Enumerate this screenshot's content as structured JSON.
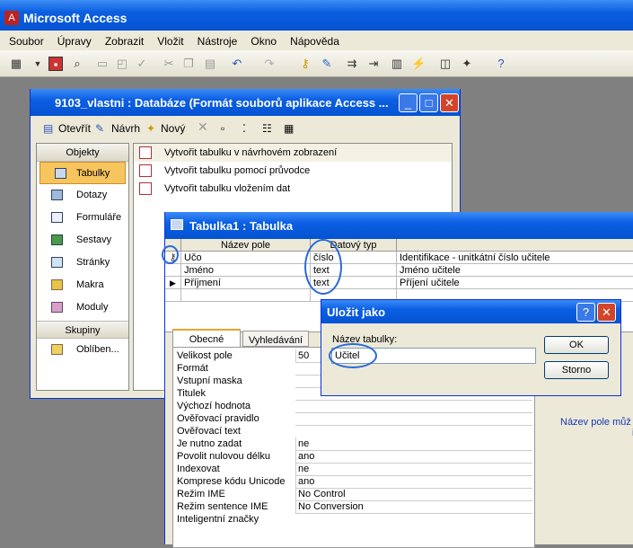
{
  "app": {
    "title": "Microsoft Access"
  },
  "menu": [
    "Soubor",
    "Úpravy",
    "Zobrazit",
    "Vložit",
    "Nástroje",
    "Okno",
    "Nápověda"
  ],
  "db_window": {
    "title": "9103_vlastni : Databáze (Formát souborů aplikace Access ...",
    "toolbar": {
      "open": "Otevřít",
      "design": "Návrh",
      "new": "Nový"
    },
    "objects_header": "Objekty",
    "objects": [
      "Tabulky",
      "Dotazy",
      "Formuláře",
      "Sestavy",
      "Stránky",
      "Makra",
      "Moduly"
    ],
    "groups_header": "Skupiny",
    "groups": [
      "Oblíben..."
    ],
    "list": [
      "Vytvořit tabulku v návrhovém zobrazení",
      "Vytvořit tabulku pomocí průvodce",
      "Vytvořit tabulku vložením dat"
    ]
  },
  "table_window": {
    "title": "Tabulka1 : Tabulka",
    "headers": [
      "Název pole",
      "Datový typ",
      ""
    ],
    "rows": [
      {
        "name": "Učo",
        "type": "číslo",
        "desc": "Identifikace - unitkátní číslo učitele"
      },
      {
        "name": "Jméno",
        "type": "text",
        "desc": "Jméno učitele"
      },
      {
        "name": "Příjmení",
        "type": "text",
        "desc": "Příjení učitele"
      }
    ],
    "tabs": [
      "Obecné",
      "Vyhledávání"
    ],
    "props": [
      {
        "label": "Velikost pole",
        "value": "50"
      },
      {
        "label": "Formát",
        "value": ""
      },
      {
        "label": "Vstupní maska",
        "value": ""
      },
      {
        "label": "Titulek",
        "value": ""
      },
      {
        "label": "Výchozí hodnota",
        "value": ""
      },
      {
        "label": "Ověřovací pravidlo",
        "value": ""
      },
      {
        "label": "Ověřovací text",
        "value": ""
      },
      {
        "label": "Je nutno zadat",
        "value": "ne"
      },
      {
        "label": "Povolit nulovou délku",
        "value": "ano"
      },
      {
        "label": "Indexovat",
        "value": "ne"
      },
      {
        "label": "Komprese kódu Unicode",
        "value": "ano"
      },
      {
        "label": "Režim IME",
        "value": "No Control"
      },
      {
        "label": "Režim sentence IME",
        "value": "No Conversion"
      },
      {
        "label": "Inteligentní značky",
        "value": ""
      }
    ],
    "hint_1": "Název pole můž",
    "hint_2": "i"
  },
  "dialog": {
    "title": "Uložit jako",
    "label": "Název tabulky:",
    "value": "Učitel",
    "ok": "OK",
    "cancel": "Storno"
  },
  "colors": {
    "titlebar": "#0453d2",
    "selection": "#f7c55e",
    "annotation": "#2a6ad8"
  }
}
